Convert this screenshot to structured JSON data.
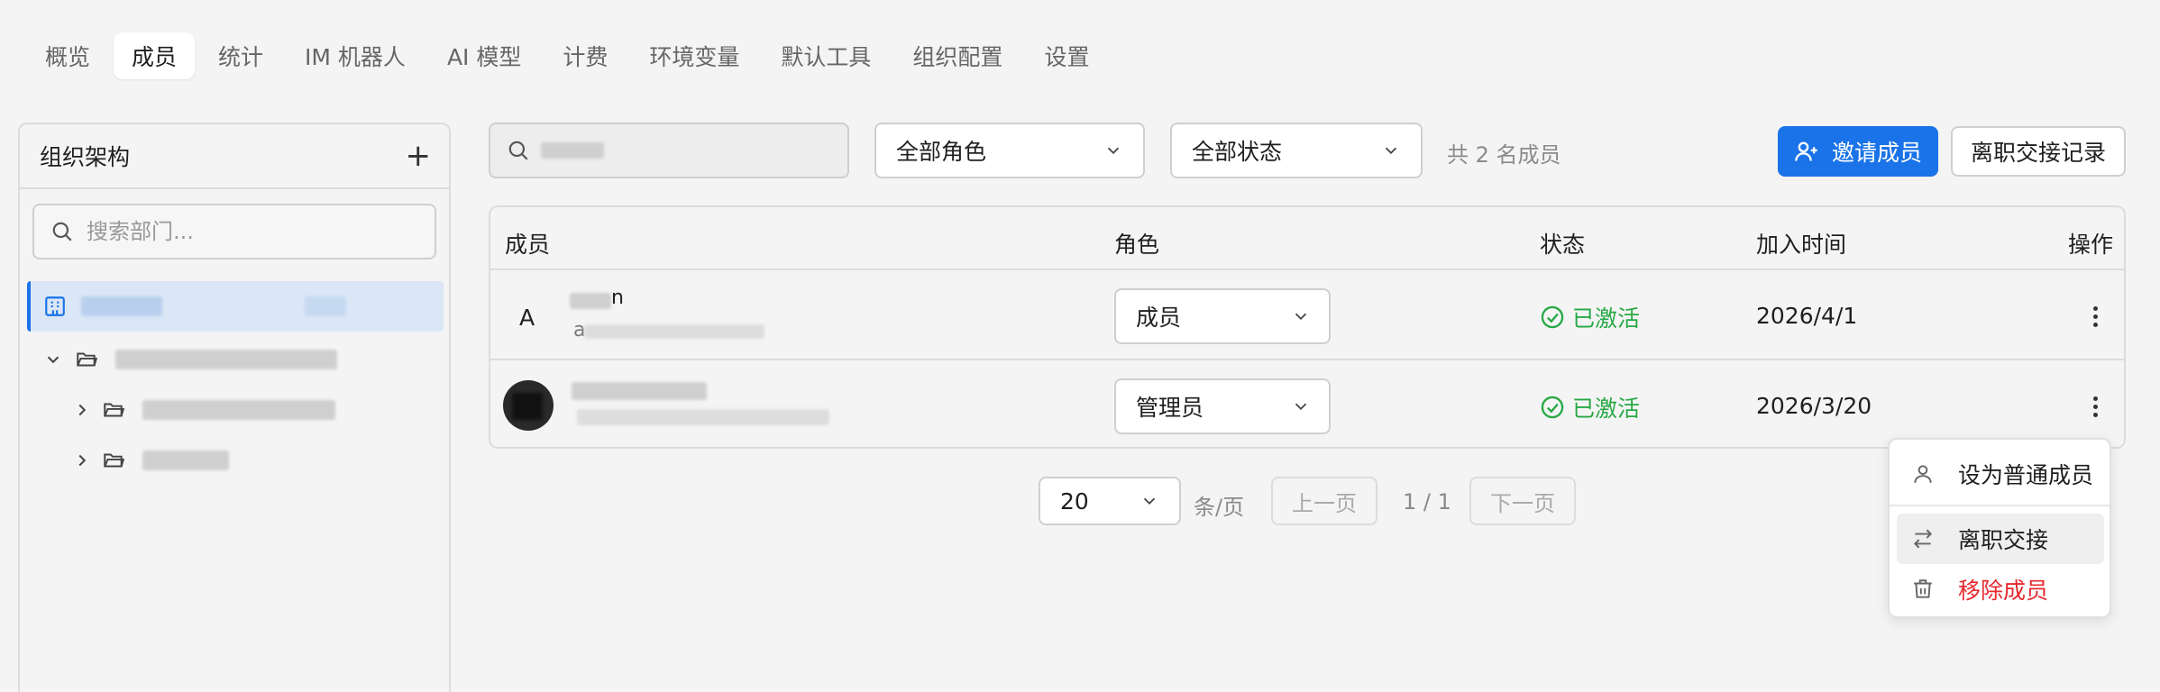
{
  "nav": {
    "tabs": [
      "概览",
      "成员",
      "统计",
      "IM 机器人",
      "AI 模型",
      "计费",
      "环境变量",
      "默认工具",
      "组织配置",
      "设置"
    ],
    "active_index": 1
  },
  "org": {
    "title": "组织架构",
    "add_symbol": "+",
    "search_placeholder": "搜索部门..."
  },
  "toolbar": {
    "role_filter": "全部角色",
    "status_filter": "全部状态",
    "member_count": "共 2 名成员",
    "invite_label": "邀请成员",
    "handover_label": "离职交接记录"
  },
  "table": {
    "headers": {
      "member": "成员",
      "role": "角色",
      "status": "状态",
      "joined": "加入时间",
      "actions": "操作"
    },
    "rows": [
      {
        "avatar_initial": "A",
        "name_visible": "n",
        "email_visible": "a",
        "role": "成员",
        "status": "已激活",
        "joined": "2026/4/1"
      },
      {
        "avatar_initial": "",
        "name_visible": "",
        "email_visible": "",
        "role": "管理员",
        "status": "已激活",
        "joined": "2026/3/20"
      }
    ]
  },
  "pagination": {
    "page_size": "20",
    "per_page_label": "条/页",
    "prev_label": "上一页",
    "page_info": "1 / 1",
    "next_label": "下一页"
  },
  "menu": {
    "items": [
      {
        "label": "设为普通成员",
        "icon": "user-icon"
      },
      {
        "label": "离职交接",
        "icon": "swap-icon"
      },
      {
        "label": "移除成员",
        "icon": "trash-icon"
      }
    ]
  },
  "colors": {
    "primary": "#1a73e8",
    "success": "#27a844",
    "danger": "#e5292e"
  }
}
